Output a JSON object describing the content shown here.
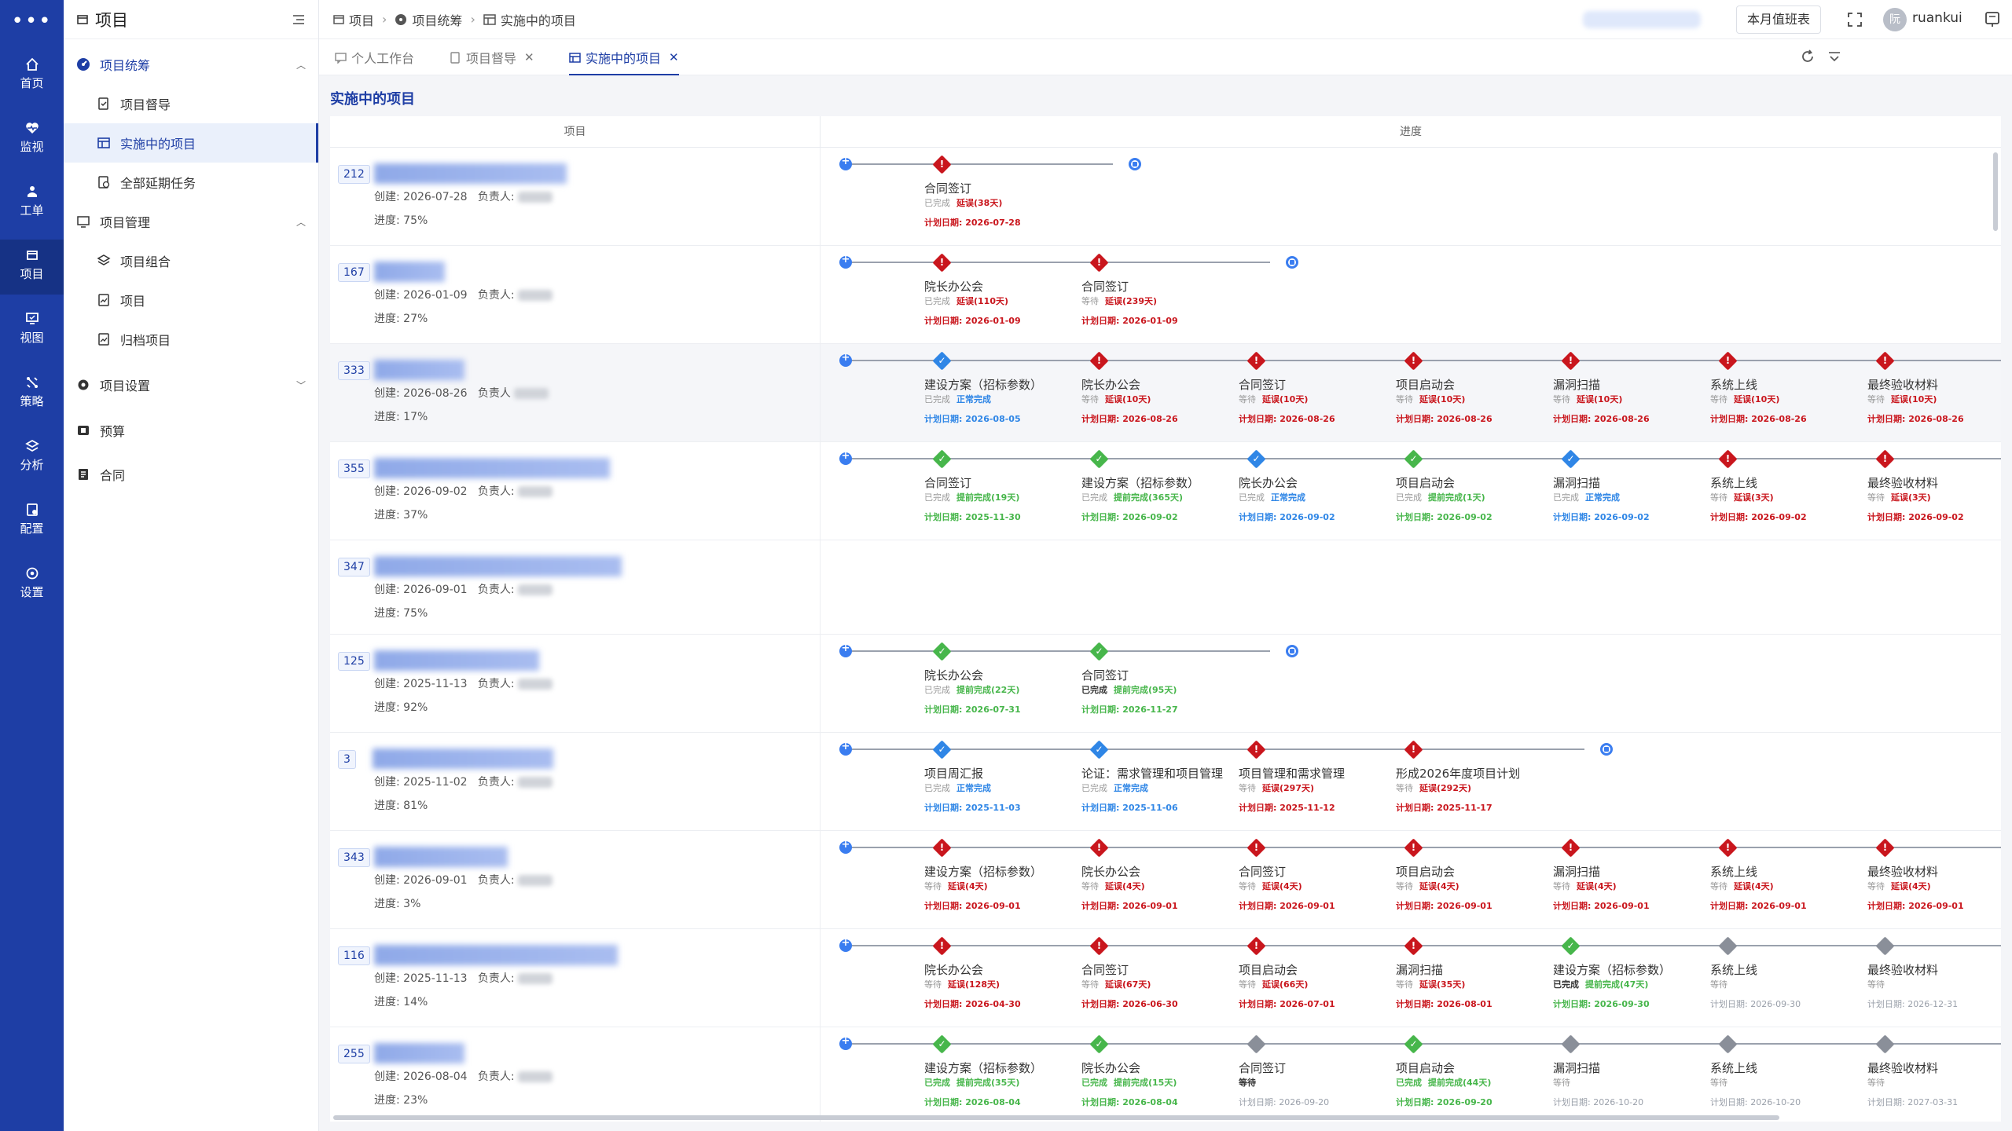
{
  "rail": {
    "items": [
      {
        "label": "首页",
        "icon": "home-icon"
      },
      {
        "label": "监视",
        "icon": "monitor-heart-icon"
      },
      {
        "label": "工单",
        "icon": "ticket-icon"
      },
      {
        "label": "项目",
        "icon": "project-icon",
        "active": true
      },
      {
        "label": "视图",
        "icon": "view-icon"
      },
      {
        "label": "策略",
        "icon": "strategy-icon"
      },
      {
        "label": "分析",
        "icon": "analysis-icon"
      },
      {
        "label": "配置",
        "icon": "config-icon"
      },
      {
        "label": "设置",
        "icon": "settings-icon"
      }
    ]
  },
  "menu": {
    "title": "项目",
    "group1": "项目统筹",
    "group1_items": [
      "项目督导",
      "实施中的项目",
      "全部延期任务"
    ],
    "group2": "项目管理",
    "group2_items": [
      "项目组合",
      "项目",
      "归档项目"
    ],
    "group3": "项目设置",
    "item_budget": "预算",
    "item_contract": "合同"
  },
  "topbar": {
    "breadcrumb": [
      "项目",
      "项目统筹",
      "实施中的项目"
    ],
    "duty_button": "本月值班表",
    "avatar_text": "阮",
    "username": "ruankui"
  },
  "tabs": [
    {
      "label": "个人工作台",
      "closable": false
    },
    {
      "label": "项目督导",
      "closable": true
    },
    {
      "label": "实施中的项目",
      "closable": true,
      "active": true
    }
  ],
  "page": {
    "title": "实施中的项目",
    "col_project": "项目",
    "col_progress": "进度"
  },
  "labels": {
    "created": "创建:",
    "owner": "负责人:",
    "owner_nocolon": "负责人",
    "progress": "进度:",
    "plan_date": "计划日期:"
  },
  "colors": {
    "primary": "#1e3ea5",
    "delay_red": "#c9161d",
    "done_green": "#47b64b",
    "normal_blue": "#2f86e6",
    "wait_gray": "#8a8f99"
  },
  "projects": [
    {
      "id": "212",
      "created": "2026-07-28",
      "progress": "75%",
      "owner_colon": true,
      "end": true,
      "milestones": [
        {
          "name": "合同签订",
          "status": "已完成",
          "detail": "延误(38天)",
          "date": "2026-07-28",
          "color": "red"
        }
      ]
    },
    {
      "id": "167",
      "created": "2026-01-09",
      "progress": "27%",
      "owner_colon": true,
      "end": true,
      "milestones": [
        {
          "name": "院长办公会",
          "status": "已完成",
          "detail": "延误(110天)",
          "date": "2026-01-09",
          "color": "red"
        },
        {
          "name": "合同签订",
          "status": "等待",
          "detail": "延误(239天)",
          "date": "2026-01-09",
          "color": "red"
        }
      ]
    },
    {
      "id": "333",
      "created": "2026-08-26",
      "progress": "17%",
      "owner_colon": false,
      "end": false,
      "hover": true,
      "milestones": [
        {
          "name": "建设方案（招标参数）",
          "status": "已完成",
          "detail": "正常完成",
          "date": "2026-08-05",
          "color": "blue"
        },
        {
          "name": "院长办公会",
          "status": "等待",
          "detail": "延误(10天)",
          "date": "2026-08-26",
          "color": "red"
        },
        {
          "name": "合同签订",
          "status": "等待",
          "detail": "延误(10天)",
          "date": "2026-08-26",
          "color": "red"
        },
        {
          "name": "项目启动会",
          "status": "等待",
          "detail": "延误(10天)",
          "date": "2026-08-26",
          "color": "red"
        },
        {
          "name": "漏洞扫描",
          "status": "等待",
          "detail": "延误(10天)",
          "date": "2026-08-26",
          "color": "red"
        },
        {
          "name": "系统上线",
          "status": "等待",
          "detail": "延误(10天)",
          "date": "2026-08-26",
          "color": "red"
        },
        {
          "name": "最终验收材料",
          "status": "等待",
          "detail": "延误(10天)",
          "date": "2026-08-26",
          "color": "red"
        }
      ]
    },
    {
      "id": "355",
      "created": "2026-09-02",
      "progress": "37%",
      "owner_colon": true,
      "end": false,
      "milestones": [
        {
          "name": "合同签订",
          "status": "已完成",
          "detail": "提前完成(19天)",
          "date": "2025-11-30",
          "color": "green"
        },
        {
          "name": "建设方案（招标参数）",
          "status": "已完成",
          "detail": "提前完成(365天)",
          "date": "2026-09-02",
          "color": "green"
        },
        {
          "name": "院长办公会",
          "status": "已完成",
          "detail": "正常完成",
          "date": "2026-09-02",
          "color": "blue"
        },
        {
          "name": "项目启动会",
          "status": "已完成",
          "detail": "提前完成(1天)",
          "date": "2026-09-02",
          "color": "green"
        },
        {
          "name": "漏洞扫描",
          "status": "已完成",
          "detail": "正常完成",
          "date": "2026-09-02",
          "color": "blue"
        },
        {
          "name": "系统上线",
          "status": "等待",
          "detail": "延误(3天)",
          "date": "2026-09-02",
          "color": "red"
        },
        {
          "name": "最终验收材料",
          "status": "等待",
          "detail": "延误(3天)",
          "date": "2026-09-02",
          "color": "red"
        }
      ]
    },
    {
      "id": "347",
      "created": "2026-09-01",
      "progress": "75%",
      "owner_colon": true,
      "end": false,
      "no_timeline": true,
      "milestones": []
    },
    {
      "id": "125",
      "created": "2025-11-13",
      "progress": "92%",
      "owner_colon": true,
      "end": true,
      "milestones": [
        {
          "name": "院长办公会",
          "status": "已完成",
          "detail": "提前完成(22天)",
          "date": "2026-07-31",
          "color": "green"
        },
        {
          "name": "合同签订",
          "status": "已完成",
          "detail": "提前完成(95天)",
          "date": "2026-11-27",
          "color": "green",
          "status_dark": true
        }
      ]
    },
    {
      "id": "3",
      "created": "2025-11-02",
      "progress": "81%",
      "owner_colon": true,
      "end": true,
      "milestones": [
        {
          "name": "项目周汇报",
          "status": "已完成",
          "detail": "正常完成",
          "date": "2025-11-03",
          "color": "blue"
        },
        {
          "name": "论证：需求管理和项目管理",
          "status": "已完成",
          "detail": "正常完成",
          "date": "2025-11-06",
          "color": "blue"
        },
        {
          "name": "项目管理和需求管理",
          "status": "等待",
          "detail": "延误(297天)",
          "date": "2025-11-12",
          "color": "red"
        },
        {
          "name": "形成2026年度项目计划",
          "status": "等待",
          "detail": "延误(292天)",
          "date": "2025-11-17",
          "color": "red"
        }
      ]
    },
    {
      "id": "343",
      "created": "2026-09-01",
      "progress": "3%",
      "owner_colon": true,
      "end": false,
      "milestones": [
        {
          "name": "建设方案（招标参数）",
          "status": "等待",
          "detail": "延误(4天)",
          "date": "2026-09-01",
          "color": "red"
        },
        {
          "name": "院长办公会",
          "status": "等待",
          "detail": "延误(4天)",
          "date": "2026-09-01",
          "color": "red"
        },
        {
          "name": "合同签订",
          "status": "等待",
          "detail": "延误(4天)",
          "date": "2026-09-01",
          "color": "red"
        },
        {
          "name": "项目启动会",
          "status": "等待",
          "detail": "延误(4天)",
          "date": "2026-09-01",
          "color": "red"
        },
        {
          "name": "漏洞扫描",
          "status": "等待",
          "detail": "延误(4天)",
          "date": "2026-09-01",
          "color": "red"
        },
        {
          "name": "系统上线",
          "status": "等待",
          "detail": "延误(4天)",
          "date": "2026-09-01",
          "color": "red"
        },
        {
          "name": "最终验收材料",
          "status": "等待",
          "detail": "延误(4天)",
          "date": "2026-09-01",
          "color": "red"
        }
      ]
    },
    {
      "id": "116",
      "created": "2025-11-13",
      "progress": "14%",
      "owner_colon": true,
      "end": false,
      "milestones": [
        {
          "name": "院长办公会",
          "status": "等待",
          "detail": "延误(128天)",
          "date": "2026-04-30",
          "color": "red"
        },
        {
          "name": "合同签订",
          "status": "等待",
          "detail": "延误(67天)",
          "date": "2026-06-30",
          "color": "red"
        },
        {
          "name": "项目启动会",
          "status": "等待",
          "detail": "延误(66天)",
          "date": "2026-07-01",
          "color": "red"
        },
        {
          "name": "漏洞扫描",
          "status": "等待",
          "detail": "延误(35天)",
          "date": "2026-08-01",
          "color": "red"
        },
        {
          "name": "建设方案（招标参数）",
          "status": "已完成",
          "detail": "提前完成(47天)",
          "date": "2026-09-30",
          "color": "green",
          "status_dark": true
        },
        {
          "name": "系统上线",
          "status": "等待",
          "detail": "",
          "date": "2026-09-30",
          "color": "gray"
        },
        {
          "name": "最终验收材料",
          "status": "等待",
          "detail": "",
          "date": "2026-12-31",
          "color": "gray"
        }
      ]
    },
    {
      "id": "255",
      "created": "2026-08-04",
      "progress": "23%",
      "owner_colon": true,
      "end": false,
      "milestones": [
        {
          "name": "建设方案（招标参数）",
          "status": "已完成",
          "detail": "提前完成(35天)",
          "date": "2026-08-04",
          "color": "green",
          "status_green": true
        },
        {
          "name": "院长办公会",
          "status": "已完成",
          "detail": "提前完成(15天)",
          "date": "2026-08-04",
          "color": "green",
          "status_green": true
        },
        {
          "name": "合同签订",
          "status": "等待",
          "detail": "",
          "date": "2026-09-20",
          "color": "gray",
          "status_dark": true
        },
        {
          "name": "项目启动会",
          "status": "已完成",
          "detail": "提前完成(44天)",
          "date": "2026-09-20",
          "color": "green",
          "status_green": true
        },
        {
          "name": "漏洞扫描",
          "status": "等待",
          "detail": "",
          "date": "2026-10-20",
          "color": "gray"
        },
        {
          "name": "系统上线",
          "status": "等待",
          "detail": "",
          "date": "2026-10-20",
          "color": "gray"
        },
        {
          "name": "最终验收材料",
          "status": "等待",
          "detail": "",
          "date": "2027-03-31",
          "color": "gray"
        }
      ]
    }
  ]
}
